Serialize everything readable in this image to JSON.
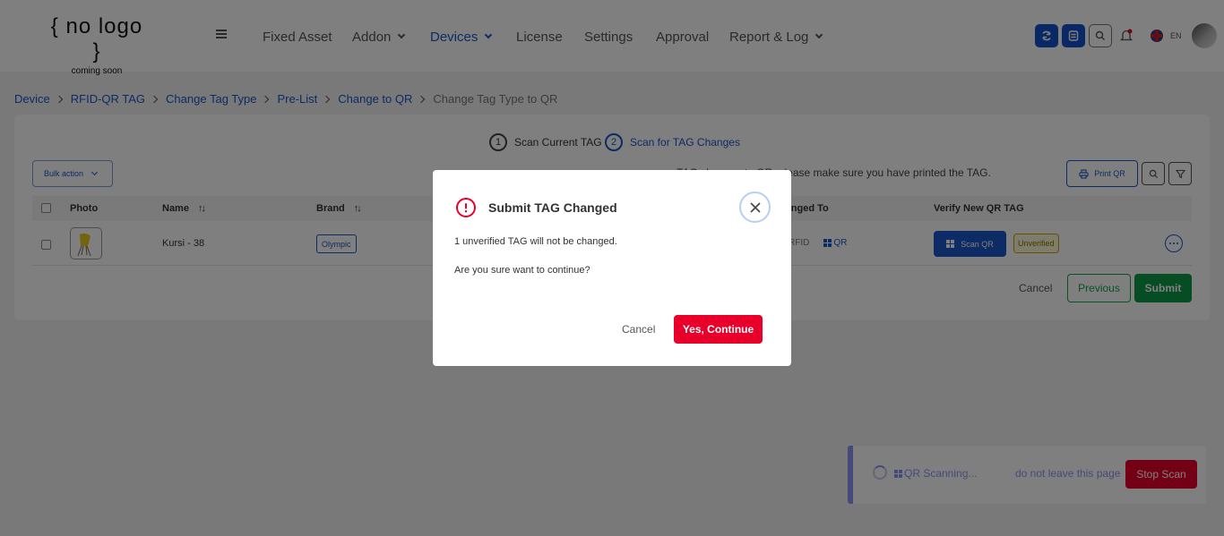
{
  "header": {
    "logo_line1": "{ no logo }",
    "logo_line2": "coming soon",
    "nav": [
      "Fixed Asset",
      "Addon",
      "Devices",
      "License",
      "Settings",
      "Approval",
      "Report & Log"
    ],
    "active_nav": "Devices",
    "language": "EN"
  },
  "breadcrumb": {
    "items": [
      "Device",
      "RFID-QR TAG",
      "Change Tag Type",
      "Pre-List",
      "Change to QR"
    ],
    "current": "Change Tag Type to QR"
  },
  "stepper": {
    "step1_num": "1",
    "step1_label": "Scan Current TAG",
    "step2_num": "2",
    "step2_label": "Scan for TAG Changes"
  },
  "toolbar": {
    "bulk_action": "Bulk action",
    "notice": "TAG changes to QR, please make sure you have printed the TAG.",
    "print_qr": "Print QR"
  },
  "table": {
    "headers": {
      "photo": "Photo",
      "name": "Name",
      "brand": "Brand",
      "changed_to": "Changed To",
      "verify": "Verify New QR TAG"
    },
    "rows": [
      {
        "name": "Kursi - 38",
        "brand": "Olympic",
        "from": "RFID",
        "to": "QR",
        "scan_btn": "Scan QR",
        "status": "Unverified"
      }
    ]
  },
  "footer": {
    "cancel": "Cancel",
    "previous": "Previous",
    "submit": "Submit"
  },
  "toast": {
    "scanning": "QR Scanning...",
    "warning": "do not leave this page",
    "stop": "Stop Scan"
  },
  "modal": {
    "title": "Submit TAG Changed",
    "message1": "1 unverified TAG will not be changed.",
    "message2": "Are you sure want to continue?",
    "cancel": "Cancel",
    "confirm": "Yes, Continue"
  },
  "colors": {
    "primary": "#1a56c8",
    "danger": "#e8002a",
    "success": "#0f9b46",
    "toast_accent": "#8a94f0",
    "overlay": "rgba(0,0,0,0.5)"
  }
}
